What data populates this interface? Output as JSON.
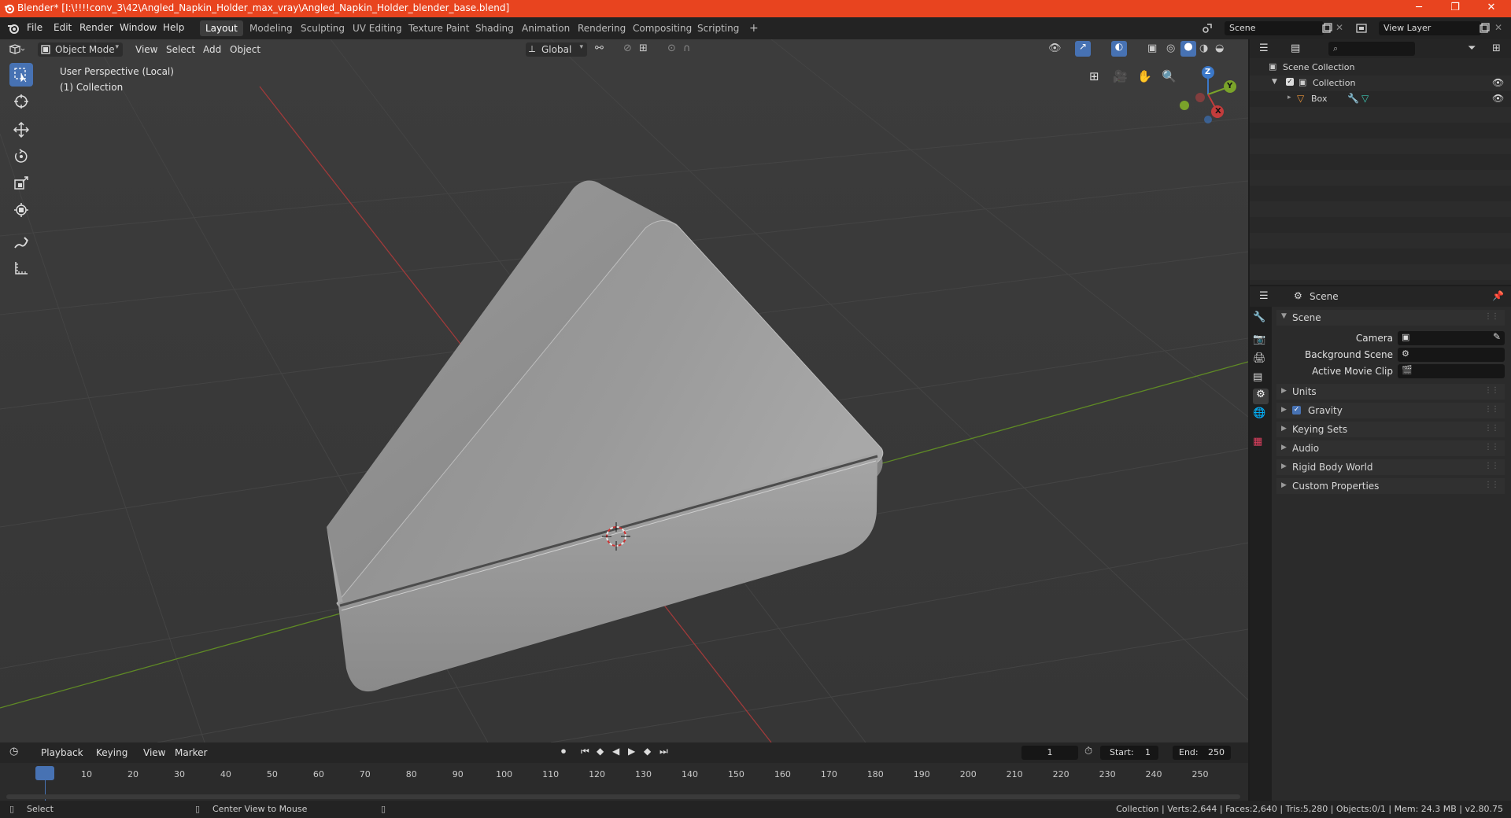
{
  "window": {
    "title": "Blender* [I:\\!!!!conv_3\\42\\Angled_Napkin_Holder_max_vray\\Angled_Napkin_Holder_blender_base.blend]",
    "minimize": "─",
    "restore": "❐",
    "close": "✕"
  },
  "menu": {
    "items": [
      "File",
      "Edit",
      "Render",
      "Window",
      "Help"
    ],
    "workspaces": [
      "Layout",
      "Modeling",
      "Sculpting",
      "UV Editing",
      "Texture Paint",
      "Shading",
      "Animation",
      "Rendering",
      "Compositing",
      "Scripting"
    ],
    "add_workspace": "+",
    "scene": "Scene",
    "view_layer": "View Layer"
  },
  "viewport": {
    "mode": "Object Mode",
    "menus": [
      "View",
      "Select",
      "Add",
      "Object"
    ],
    "orientation": "Global",
    "overlay_line1": "User Perspective (Local)",
    "overlay_line2": "(1) Collection",
    "gizmo": {
      "z": "Z",
      "y": "Y",
      "x": "X"
    }
  },
  "timeline": {
    "menus": [
      "Playback",
      "Keying",
      "View",
      "Marker"
    ],
    "current_frame": "1",
    "start_label": "Start:",
    "start": "1",
    "end_label": "End:",
    "end": "250",
    "ticks": [
      "1",
      "10",
      "20",
      "30",
      "40",
      "50",
      "60",
      "70",
      "80",
      "90",
      "100",
      "110",
      "120",
      "130",
      "140",
      "150",
      "160",
      "170",
      "180",
      "190",
      "200",
      "210",
      "220",
      "230",
      "240",
      "250"
    ]
  },
  "outliner": {
    "root": "Scene Collection",
    "collection": "Collection",
    "object": "Box"
  },
  "properties": {
    "header": "Scene",
    "panel": "Scene",
    "camera_label": "Camera",
    "background_label": "Background Scene",
    "movie_clip_label": "Active Movie Clip",
    "sections": [
      "Units",
      "Gravity",
      "Keying Sets",
      "Audio",
      "Rigid Body World",
      "Custom Properties"
    ],
    "gravity_checked": true
  },
  "status": {
    "select": "Select",
    "center": "Center View to Mouse",
    "stats": "Collection | Verts:2,644 | Faces:2,640 | Tris:5,280 | Objects:0/1 | Mem: 24.3 MB | v2.80.75"
  },
  "colors": {
    "title_bar": "#e8441f",
    "accent": "#4772b3",
    "x_axis": "#b33c3c",
    "y_axis": "#6a9a2a"
  }
}
